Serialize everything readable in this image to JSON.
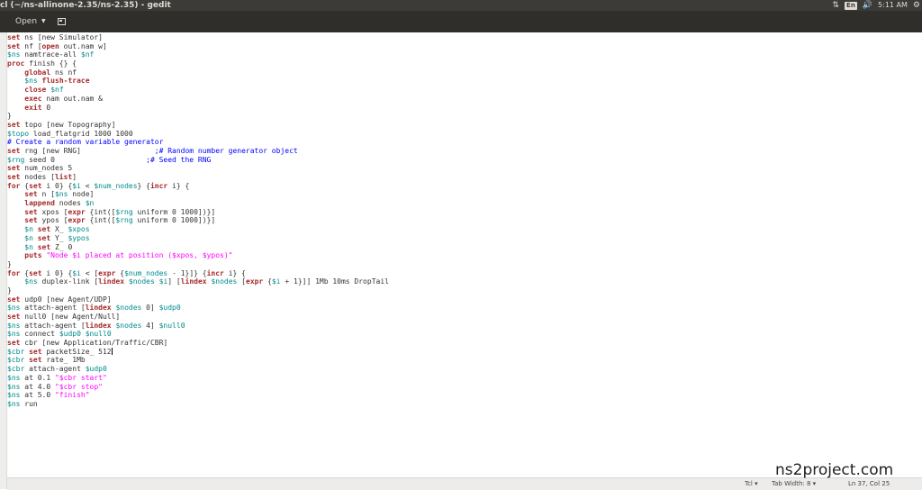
{
  "window": {
    "title": "cl (~/ns-allinone-2.35/ns-2.35) - gedit"
  },
  "system_tray": {
    "keyboard": "En",
    "time": "5:11 AM"
  },
  "toolbar": {
    "open_label": "Open"
  },
  "code_lines": [
    [
      {
        "t": "set",
        "c": "kw"
      },
      {
        "t": " ns [new Simulator]"
      }
    ],
    [
      {
        "t": "set",
        "c": "kw"
      },
      {
        "t": " nf ["
      },
      {
        "t": "open",
        "c": "kw"
      },
      {
        "t": " out.nam w]"
      }
    ],
    [
      {
        "t": "$ns",
        "c": "var"
      },
      {
        "t": " namtrace-all "
      },
      {
        "t": "$nf",
        "c": "var"
      }
    ],
    [
      {
        "t": "proc",
        "c": "kw"
      },
      {
        "t": " finish {} {"
      }
    ],
    [
      {
        "t": "    "
      },
      {
        "t": "global",
        "c": "kw"
      },
      {
        "t": " ns nf"
      }
    ],
    [
      {
        "t": "    "
      },
      {
        "t": "$ns",
        "c": "var"
      },
      {
        "t": " "
      },
      {
        "t": "flush-trace",
        "c": "kw"
      }
    ],
    [
      {
        "t": "    "
      },
      {
        "t": "close",
        "c": "kw"
      },
      {
        "t": " "
      },
      {
        "t": "$nf",
        "c": "var"
      }
    ],
    [
      {
        "t": "    "
      },
      {
        "t": "exec",
        "c": "kw"
      },
      {
        "t": " nam out.nam &"
      }
    ],
    [
      {
        "t": "    "
      },
      {
        "t": "exit",
        "c": "kw"
      },
      {
        "t": " 0"
      }
    ],
    [
      {
        "t": "}"
      }
    ],
    [
      {
        "t": "set",
        "c": "kw"
      },
      {
        "t": " topo [new Topography]"
      }
    ],
    [
      {
        "t": "$topo",
        "c": "var"
      },
      {
        "t": " load_flatgrid 1000 1000"
      }
    ],
    [
      {
        "t": "# Create a random variable generator",
        "c": "com"
      }
    ],
    [
      {
        "t": "set",
        "c": "kw"
      },
      {
        "t": " rng [new RNG]                 "
      },
      {
        "t": ";# Random number generator object",
        "c": "com"
      }
    ],
    [
      {
        "t": "$rng",
        "c": "var"
      },
      {
        "t": " seed 0                     "
      },
      {
        "t": ";# Seed the RNG",
        "c": "com"
      }
    ],
    [
      {
        "t": "set",
        "c": "kw"
      },
      {
        "t": " num_nodes 5"
      }
    ],
    [
      {
        "t": "set",
        "c": "kw"
      },
      {
        "t": " nodes ["
      },
      {
        "t": "list",
        "c": "kw"
      },
      {
        "t": "]"
      }
    ],
    [
      {
        "t": "for",
        "c": "kw"
      },
      {
        "t": " {"
      },
      {
        "t": "set",
        "c": "kw"
      },
      {
        "t": " i 0} {"
      },
      {
        "t": "$i",
        "c": "var"
      },
      {
        "t": " < "
      },
      {
        "t": "$num_nodes",
        "c": "var"
      },
      {
        "t": "} {"
      },
      {
        "t": "incr",
        "c": "kw"
      },
      {
        "t": " i} {"
      }
    ],
    [
      {
        "t": "    "
      },
      {
        "t": "set",
        "c": "kw"
      },
      {
        "t": " n ["
      },
      {
        "t": "$ns",
        "c": "var"
      },
      {
        "t": " node]"
      }
    ],
    [
      {
        "t": "    "
      },
      {
        "t": "lappend",
        "c": "kw"
      },
      {
        "t": " nodes "
      },
      {
        "t": "$n",
        "c": "var"
      }
    ],
    [
      {
        "t": "    "
      },
      {
        "t": "set",
        "c": "kw"
      },
      {
        "t": " xpos ["
      },
      {
        "t": "expr",
        "c": "kw"
      },
      {
        "t": " {int(["
      },
      {
        "t": "$rng",
        "c": "var"
      },
      {
        "t": " uniform 0 1000])}]"
      }
    ],
    [
      {
        "t": "    "
      },
      {
        "t": "set",
        "c": "kw"
      },
      {
        "t": " ypos ["
      },
      {
        "t": "expr",
        "c": "kw"
      },
      {
        "t": " {int(["
      },
      {
        "t": "$rng",
        "c": "var"
      },
      {
        "t": " uniform 0 1000])}]"
      }
    ],
    [
      {
        "t": "    "
      },
      {
        "t": "$n",
        "c": "var"
      },
      {
        "t": " "
      },
      {
        "t": "set",
        "c": "kw"
      },
      {
        "t": " X_ "
      },
      {
        "t": "$xpos",
        "c": "var"
      }
    ],
    [
      {
        "t": "    "
      },
      {
        "t": "$n",
        "c": "var"
      },
      {
        "t": " "
      },
      {
        "t": "set",
        "c": "kw"
      },
      {
        "t": " Y_ "
      },
      {
        "t": "$ypos",
        "c": "var"
      }
    ],
    [
      {
        "t": "    "
      },
      {
        "t": "$n",
        "c": "var"
      },
      {
        "t": " "
      },
      {
        "t": "set",
        "c": "kw"
      },
      {
        "t": " Z_ 0"
      }
    ],
    [
      {
        "t": "    "
      },
      {
        "t": "puts",
        "c": "kw"
      },
      {
        "t": " "
      },
      {
        "t": "\"Node $i placed at position ($xpos, $ypos)\"",
        "c": "str"
      }
    ],
    [
      {
        "t": "}"
      }
    ],
    [
      {
        "t": "for",
        "c": "kw"
      },
      {
        "t": " {"
      },
      {
        "t": "set",
        "c": "kw"
      },
      {
        "t": " i 0} {"
      },
      {
        "t": "$i",
        "c": "var"
      },
      {
        "t": " < ["
      },
      {
        "t": "expr",
        "c": "kw"
      },
      {
        "t": " {"
      },
      {
        "t": "$num_nodes",
        "c": "var"
      },
      {
        "t": " - 1}]} {"
      },
      {
        "t": "incr",
        "c": "kw"
      },
      {
        "t": " i} {"
      }
    ],
    [
      {
        "t": "    "
      },
      {
        "t": "$ns",
        "c": "var"
      },
      {
        "t": " duplex-link ["
      },
      {
        "t": "lindex",
        "c": "kw"
      },
      {
        "t": " "
      },
      {
        "t": "$nodes",
        "c": "var"
      },
      {
        "t": " "
      },
      {
        "t": "$i",
        "c": "var"
      },
      {
        "t": "] ["
      },
      {
        "t": "lindex",
        "c": "kw"
      },
      {
        "t": " "
      },
      {
        "t": "$nodes",
        "c": "var"
      },
      {
        "t": " ["
      },
      {
        "t": "expr",
        "c": "kw"
      },
      {
        "t": " {"
      },
      {
        "t": "$i",
        "c": "var"
      },
      {
        "t": " + 1}]] 1Mb 10ms DropTail"
      }
    ],
    [
      {
        "t": "}"
      }
    ],
    [
      {
        "t": "set",
        "c": "kw"
      },
      {
        "t": " udp0 [new Agent/UDP]"
      }
    ],
    [
      {
        "t": "$ns",
        "c": "var"
      },
      {
        "t": " attach-agent ["
      },
      {
        "t": "lindex",
        "c": "kw"
      },
      {
        "t": " "
      },
      {
        "t": "$nodes",
        "c": "var"
      },
      {
        "t": " 0] "
      },
      {
        "t": "$udp0",
        "c": "var"
      }
    ],
    [
      {
        "t": "set",
        "c": "kw"
      },
      {
        "t": " null0 [new Agent/Null]"
      }
    ],
    [
      {
        "t": "$ns",
        "c": "var"
      },
      {
        "t": " attach-agent ["
      },
      {
        "t": "lindex",
        "c": "kw"
      },
      {
        "t": " "
      },
      {
        "t": "$nodes",
        "c": "var"
      },
      {
        "t": " 4] "
      },
      {
        "t": "$null0",
        "c": "var"
      }
    ],
    [
      {
        "t": "$ns",
        "c": "var"
      },
      {
        "t": " connect "
      },
      {
        "t": "$udp0",
        "c": "var"
      },
      {
        "t": " "
      },
      {
        "t": "$null0",
        "c": "var"
      }
    ],
    [
      {
        "t": "set",
        "c": "kw"
      },
      {
        "t": " cbr [new Application/Traffic/CBR]"
      }
    ],
    [
      {
        "t": "$cbr",
        "c": "var"
      },
      {
        "t": " "
      },
      {
        "t": "set",
        "c": "kw"
      },
      {
        "t": " packetSize_ 512"
      },
      {
        "t": "",
        "c": "cursor"
      }
    ],
    [
      {
        "t": "$cbr",
        "c": "var"
      },
      {
        "t": " "
      },
      {
        "t": "set",
        "c": "kw"
      },
      {
        "t": " rate_ 1Mb"
      }
    ],
    [
      {
        "t": "$cbr",
        "c": "var"
      },
      {
        "t": " attach-agent "
      },
      {
        "t": "$udp0",
        "c": "var"
      }
    ],
    [
      {
        "t": "$ns",
        "c": "var"
      },
      {
        "t": " at 0.1 "
      },
      {
        "t": "\"$cbr start\"",
        "c": "str"
      }
    ],
    [
      {
        "t": "$ns",
        "c": "var"
      },
      {
        "t": " at 4.0 "
      },
      {
        "t": "\"$cbr stop\"",
        "c": "str"
      }
    ],
    [
      {
        "t": "$ns",
        "c": "var"
      },
      {
        "t": " at 5.0 "
      },
      {
        "t": "\"finish\"",
        "c": "str"
      }
    ],
    [
      {
        "t": "$ns",
        "c": "var"
      },
      {
        "t": " run"
      }
    ]
  ],
  "status": {
    "language": "Tcl ▾",
    "tab_width": "Tab Width: 8 ▾",
    "position": "Ln 37, Col 25"
  },
  "watermark": "ns2project.com",
  "colors": {
    "keyword": "#a52a2a",
    "variable": "#008a8c",
    "string": "#ff00ff",
    "comment": "#0000ff"
  }
}
